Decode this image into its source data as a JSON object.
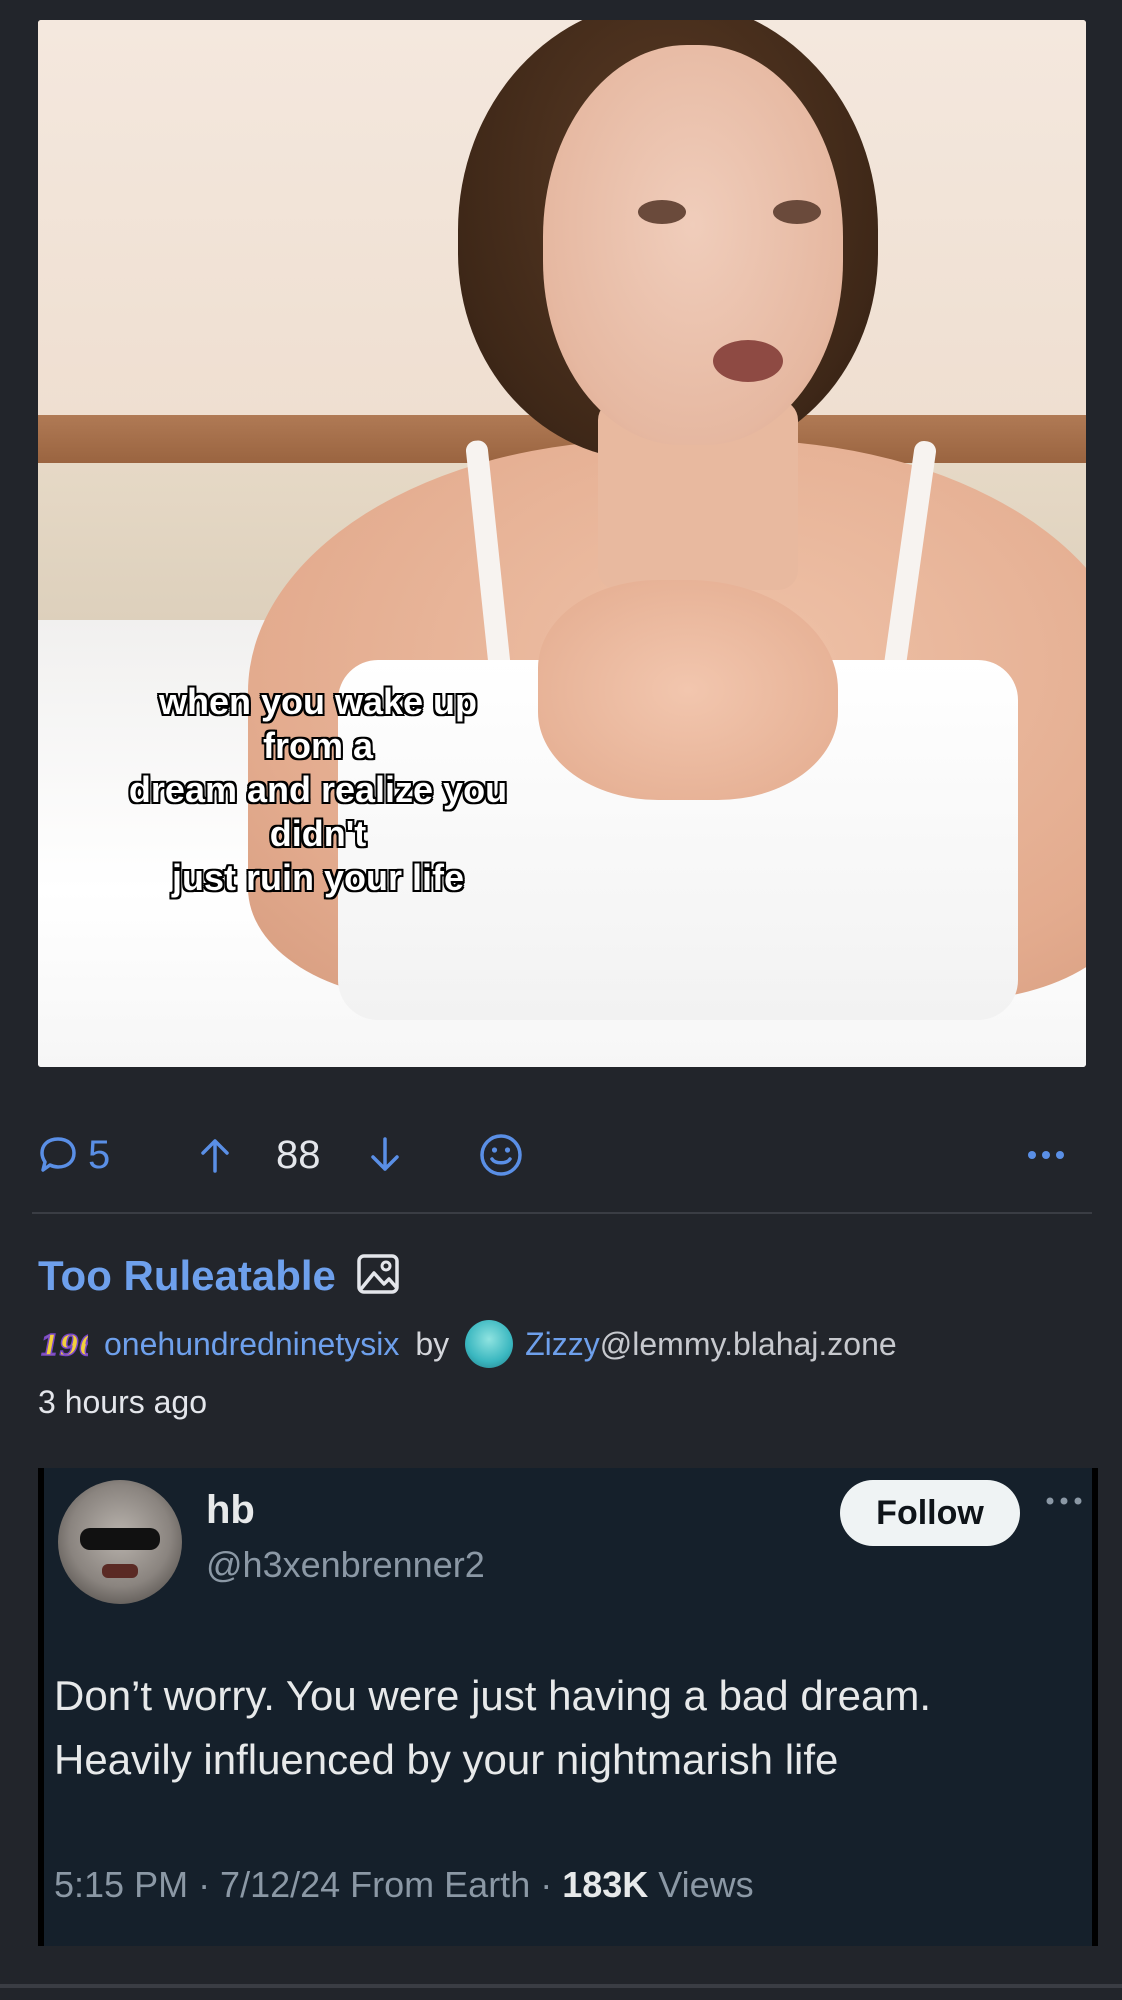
{
  "post1": {
    "image_caption": "when you wake up from a\ndream and realize you didn't\njust ruin your life",
    "comments_count": "5",
    "score": "88",
    "icons": {
      "comments": "comment-icon",
      "upvote": "arrow-up-icon",
      "downvote": "arrow-down-icon",
      "react": "smiley-icon",
      "more": "ellipsis-icon"
    }
  },
  "post2": {
    "title": "Too Ruleatable",
    "title_icon": "image-icon",
    "community": "onehundredninetysix",
    "community_badge": "196",
    "by_label": "by",
    "author_name": "Zizzy",
    "author_instance": "@lemmy.blahaj.zone",
    "time_ago": "3 hours ago"
  },
  "tweet": {
    "display_name": "hb",
    "handle": "@h3xenbrenner2",
    "follow_label": "Follow",
    "text": "Don’t worry. You were just having a bad dream. Heavily influenced by your nightmarish life",
    "timestamp": "5:15 PM · 7/12/24 From Earth ·",
    "views_count": "183K",
    "views_label": "Views"
  },
  "colors": {
    "background": "#22252b",
    "accent_blue": "#6ea0ec",
    "tweet_bg": "#15202b"
  }
}
